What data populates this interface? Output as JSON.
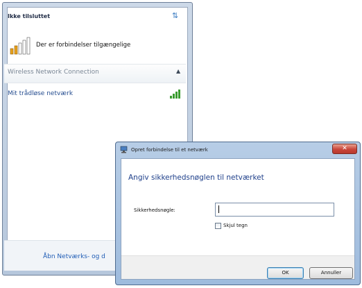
{
  "flyout": {
    "status_title": "Ikke tilsluttet",
    "refresh_icon": "refresh-icon",
    "available_text": "Der er forbindelser tilgængelige",
    "section_label": "Wireless Network Connection",
    "collapse_icon": "▲",
    "network_name": "Mit trådløse netværk",
    "network_signal_level": 1.0,
    "bottom_link": "Åbn Netværks- og d"
  },
  "dialog": {
    "title": "Opret forbindelse til et netværk",
    "close_label": "✕",
    "heading": "Angiv sikkerhedsnøglen til netværket",
    "field_label": "Sikkerhedsnøgle:",
    "field_value": "",
    "hide_chars_label": "Skjul tegn",
    "hide_chars_checked": false,
    "ok_label": "OK",
    "cancel_label": "Annuller"
  },
  "colors": {
    "accent_blue": "#1f5cb5",
    "close_red": "#c9463a",
    "signal_green": "#3a9c2f"
  }
}
